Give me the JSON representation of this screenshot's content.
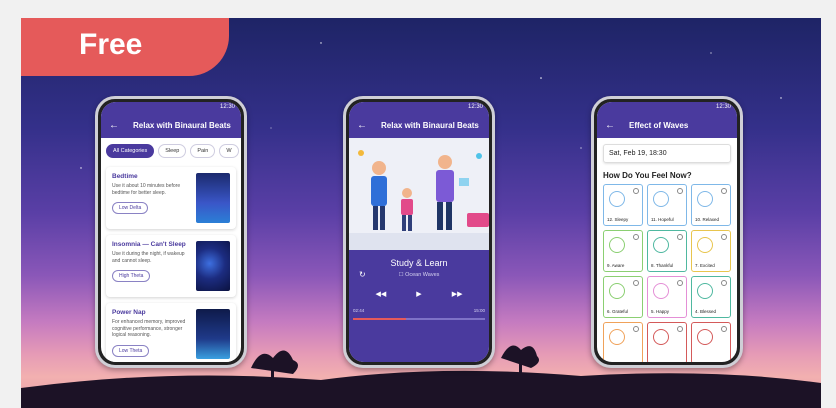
{
  "badge": {
    "label": "Free"
  },
  "phone1": {
    "status_time": "12:30",
    "title": "Relax with Binaural Beats",
    "chips": [
      "All Categories",
      "Sleep",
      "Pain",
      "W"
    ],
    "cards": [
      {
        "title": "Bedtime",
        "desc": "Use it about 10 minutes before bedtime for better sleep.",
        "pill": "Low Delta"
      },
      {
        "title": "Insomnia — Can't Sleep",
        "desc": "Use it during the night, if wakeup and cannot sleep.",
        "pill": "High Theta"
      },
      {
        "title": "Power Nap",
        "desc": "For enhanced memory, improved cognitive performance, stronger logical reasoning.",
        "pill": "Low Theta"
      }
    ]
  },
  "phone2": {
    "status_time": "12:30",
    "title": "Relax with Binaural Beats",
    "track_title": "Study & Learn",
    "track_option": "Ocean Waves",
    "time_elapsed": "02:44",
    "time_total": "15:00",
    "progress": 0.4
  },
  "phone3": {
    "status_time": "12:30",
    "title": "Effect of Waves",
    "date": "Sat, Feb 19, 18:30",
    "question": "How Do You Feel Now?",
    "moods": [
      {
        "label": "12. Sleepy",
        "color": "blue"
      },
      {
        "label": "11. Hopeful",
        "color": "blue"
      },
      {
        "label": "10. Relaxed",
        "color": "blue"
      },
      {
        "label": "9. Aware",
        "color": "green"
      },
      {
        "label": "8. Thankful",
        "color": "teal"
      },
      {
        "label": "7. Excited",
        "color": "yellow"
      },
      {
        "label": "6. Grateful",
        "color": "green"
      },
      {
        "label": "5. Happy",
        "color": "pink"
      },
      {
        "label": "4. Blessed",
        "color": "teal"
      },
      {
        "label": "",
        "color": "orange"
      },
      {
        "label": "",
        "color": "red"
      },
      {
        "label": "",
        "color": "red"
      }
    ]
  }
}
